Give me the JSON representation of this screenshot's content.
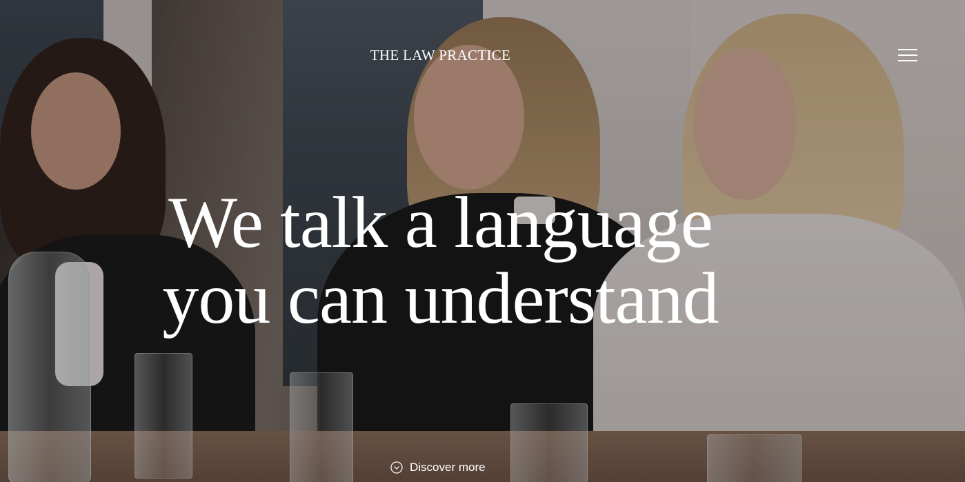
{
  "header": {
    "brand": "THE LAW PRACTICE",
    "menu_icon": "hamburger-menu-icon"
  },
  "hero": {
    "headline_line1": "We talk a language",
    "headline_line2": "you can understand",
    "discover_label": "Discover more",
    "discover_icon": "chevron-down-circle-icon"
  },
  "colors": {
    "text": "#ffffff",
    "overlay": "rgba(20,18,18,0.30)"
  }
}
